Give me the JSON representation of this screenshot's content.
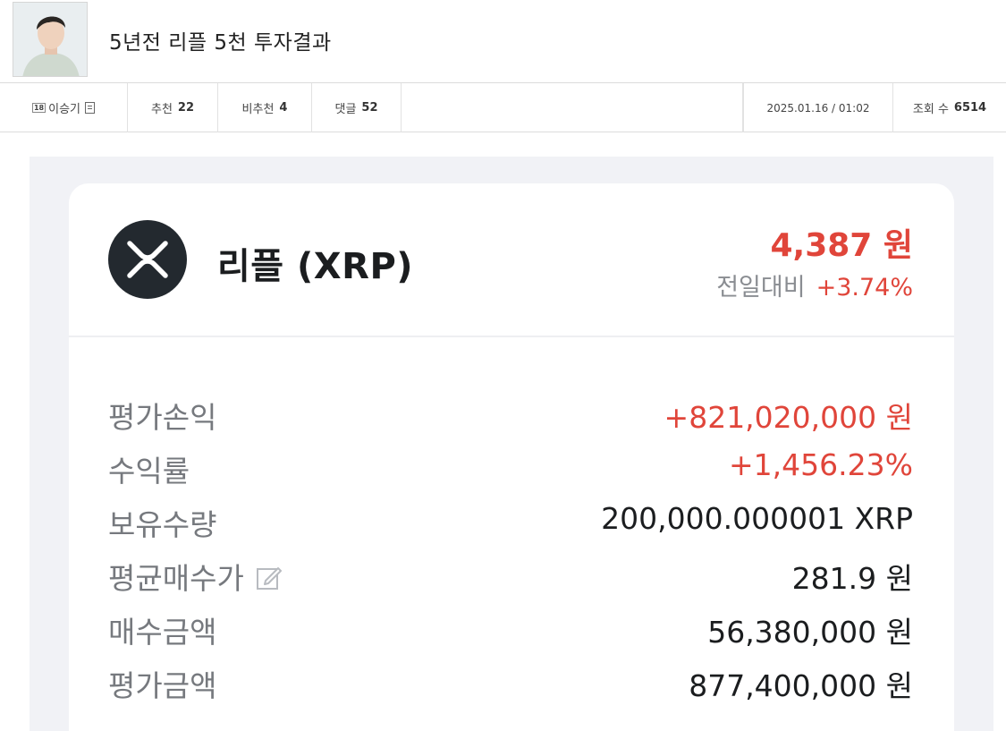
{
  "post": {
    "title": "5년전 리플 5천 투자결과",
    "author": "이승기",
    "level_badge": "18",
    "recommend_label": "추천",
    "recommend_count": "22",
    "not_recommend_label": "비추천",
    "not_recommend_count": "4",
    "comment_label": "댓글",
    "comment_count": "52",
    "datetime": "2025.01.16 / 01:02",
    "views_label": "조회 수",
    "views_count": "6514"
  },
  "asset": {
    "name": "리플 (XRP)",
    "price": "4,387 원",
    "change_label": "전일대비",
    "change_value": "+3.74%",
    "logo_icon": "xrp-logo-icon"
  },
  "rows": [
    {
      "label": "평가손익",
      "value": "+821,020,000 원",
      "color": "#e0453a"
    },
    {
      "label": "수익률",
      "value": "+1,456.23%",
      "color": "#e0453a"
    },
    {
      "label": "보유수량",
      "value": "200,000.000001 XRP",
      "color": "#1b1d1f"
    },
    {
      "label": "평균매수가",
      "value": "281.9 원",
      "color": "#1b1d1f"
    },
    {
      "label": "매수금액",
      "value": "56,380,000 원",
      "color": "#1b1d1f"
    },
    {
      "label": "평가금액",
      "value": "877,400,000 원",
      "color": "#1b1d1f"
    }
  ],
  "colors": {
    "accent_red": "#e0453a",
    "label_gray": "#76797e",
    "background": "#f1f2f6"
  }
}
